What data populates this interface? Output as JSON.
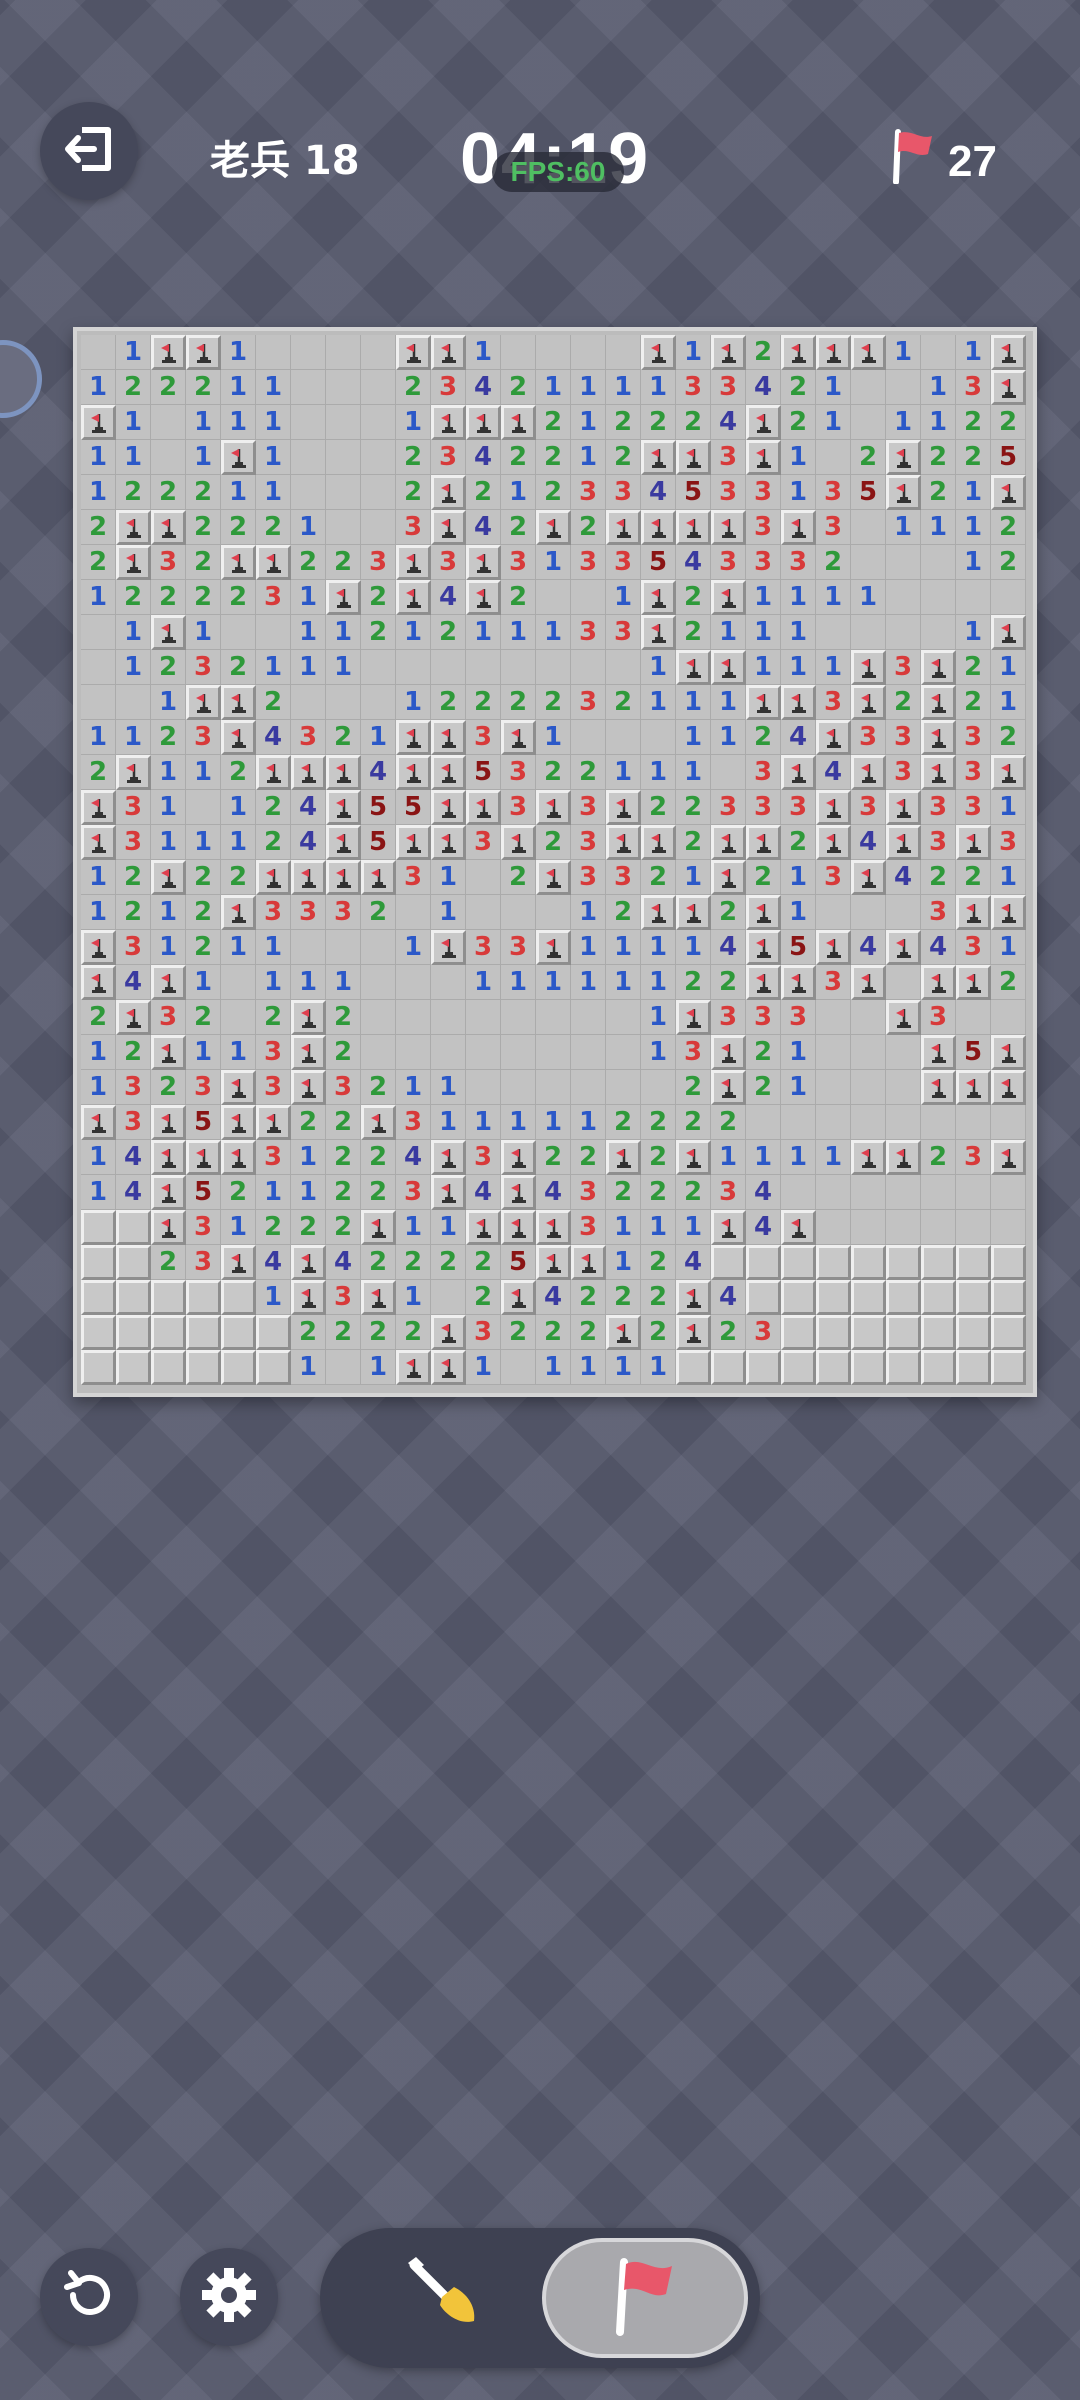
{
  "header": {
    "level_label": "老兵 18",
    "timer": "04:19",
    "fps": "FPS:60",
    "flags_remaining": "27"
  },
  "icons": {
    "exit": "exit-icon",
    "flag": "flag-icon",
    "undo": "undo-icon",
    "settings": "gear-icon",
    "dig": "shovel-icon",
    "mode_flag": "flag-icon"
  },
  "colors": {
    "n1": "#2b58c8",
    "n2": "#2e9a3a",
    "n3": "#d83a3a",
    "n4": "#3a3aa0",
    "n5": "#8a1414",
    "flag": "#e8576a"
  },
  "board": {
    "cols": 27,
    "rows": 30,
    "legend": "digits = opened number, . = opened empty, F = flag, H = covered",
    "cells": [
      ".1FF1....FF1....F1F2FFF1.1FF22F",
      "122211...2342111133421..13F45F",
      "F1.111...1FFF212224F21.1122FFF",
      "11.1F1...2342212FF3F1.2F225F.",
      "122211...2F212334533135F21FFF",
      "2FF2221..3F42F2FFFF3F3.1112232",
      "2F32FF223F3F3133543332...1221",
      "1222231F2F4F2..1F2F1111....1F2",
      ".1F1..1121211133F2111....1F4",
      ".1232111........1FF111F3F21111.2FF",
      "..1FF2...1222232111FF3F2F21223",
      "1123F4321FF3F1...1124F33F321",
      "2F112FFF4FF5322111.3F4F3F3F32",
      "F31.124F55FF3F3F22333F3F3312F",
      "F311124F5FF3F23FF2FF2F4F3F3F1..11",
      "12F22FFFF31.2F3321F213F4221221",
      "1212F3332.1...12FF2F1...3F FF2F2F1",
      "F31211...1F33F11114F5F4F431",
      "F4F1.111...11111122FF3F.FF2",
      "2F32.2F2........1F333..F3",
      "12F113F2........13F21...F5F2",
      "1323F3F3211......2F21...FFF",
      "F3F5FF22F3111112222........",
      "14FFF31224F3F22F2F1111FF23F....",
      "14F5211223F4F4322234.......",
      "HHF31222F11FFF3111F4F.......",
      "HH23F4F422225FF124HHHHHHHHHHH",
      "HHHHH1F3F1.2F4222F4HHHHHHHHHH",
      "HHHHHH2222F3222F2F23HHHHHHHHHH",
      "HHHHHH1.1FF1.1111HHHHHHHHHHH"
    ]
  }
}
